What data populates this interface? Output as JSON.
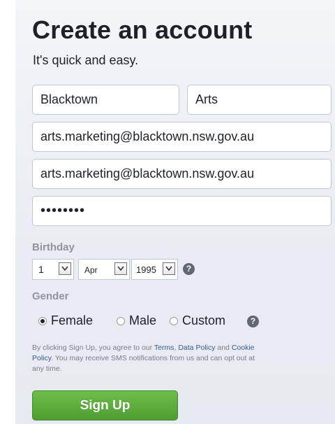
{
  "header": {
    "title": "Create an account",
    "subtitle": "It's quick and easy."
  },
  "form": {
    "first_name": "Blacktown",
    "last_name": "Arts",
    "email": "arts.marketing@blacktown.nsw.gov.au",
    "email_confirm": "arts.marketing@blacktown.nsw.gov.au",
    "password_mask": "••••••••"
  },
  "birthday": {
    "label": "Birthday",
    "day": "1",
    "month": "Apr",
    "year": "1995",
    "help_glyph": "?"
  },
  "gender": {
    "label": "Gender",
    "options": [
      "Female",
      "Male",
      "Custom"
    ],
    "selected": "Female",
    "help_glyph": "?"
  },
  "terms": {
    "part1": "By clicking Sign Up, you agree to our ",
    "terms_link": "Terms",
    "part2": ", ",
    "data_policy_link": "Data Policy",
    "part3": " and ",
    "cookie_policy_link": "Cookie Policy",
    "part4": ". You may receive SMS notifications from us and can opt out at any time."
  },
  "actions": {
    "signup_label": "Sign Up"
  },
  "colors": {
    "signup_green": "#5ba93c",
    "link_blue": "#385898",
    "panel_bg": "#eceff4"
  }
}
